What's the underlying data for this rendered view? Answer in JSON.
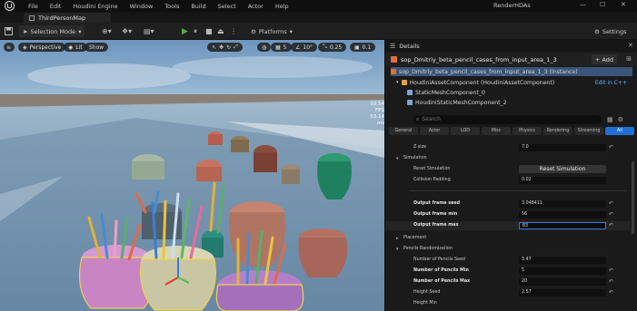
{
  "menubar": {
    "items": [
      "File",
      "Edit",
      "Houdini Engine",
      "Window",
      "Tools",
      "Build",
      "Select",
      "Actor",
      "Help"
    ],
    "project": "RenderHDAs"
  },
  "tab": {
    "label": "ThirdPersonMap"
  },
  "toolbar": {
    "selection_mode": "Selection Mode",
    "platforms": "Platforms",
    "settings": "Settings"
  },
  "viewport": {
    "perspective": "Perspective",
    "lit": "Lit",
    "show": "Show",
    "grid_snap": "5",
    "rot_snap": "10°",
    "scale_snap": "0.25",
    "cam_speed": "0.1",
    "stats": [
      "10.54 FPS",
      "53.14 ms"
    ]
  },
  "details": {
    "title": "Details",
    "actor_name": "sop_Dmitriy_beta_pencil_cases_from_input_area_1_3",
    "add_label": "Add",
    "components": [
      "sop_Dmitriy_beta_pencil_cases_from_input_area_1_3 (Instance)",
      "HoudiniAssetComponent (HoudiniAssetComponent)",
      "StaticMeshComponent_0",
      "HoudiniStaticMeshComponent_2"
    ],
    "edit_cpp": "Edit in C++",
    "search_placeholder": "Search",
    "filters": [
      "General",
      "Actor",
      "LOD",
      "Misc",
      "Physics",
      "Rendering",
      "Streaming",
      "All"
    ],
    "props": {
      "z_size_label": "Z size",
      "z_size_value": "7.0",
      "simulation_label": "Simulation",
      "reset_sim_label": "Reset Simulation",
      "reset_sim_button": "Reset Simulation",
      "collision_label": "Collision Padding",
      "collision_value": "0.02",
      "seed_label": "Output frame seed",
      "seed_value": "3.048411",
      "min_label": "Output frame min",
      "min_value": "56",
      "max_label": "Output frame max",
      "max_value": "83",
      "placement_label": "Placement",
      "pencils_rand_label": "Pencils Randomization",
      "num_seed_label": "Number of Pencils Seed",
      "num_seed_value": "3.47",
      "num_min_label": "Number of Pencils Min",
      "num_min_value": "5",
      "num_max_label": "Number of Pencils Max",
      "num_max_value": "20",
      "height_seed_label": "Height Seed",
      "height_seed_value": "2.57",
      "height_min_label": "Height Min"
    }
  }
}
